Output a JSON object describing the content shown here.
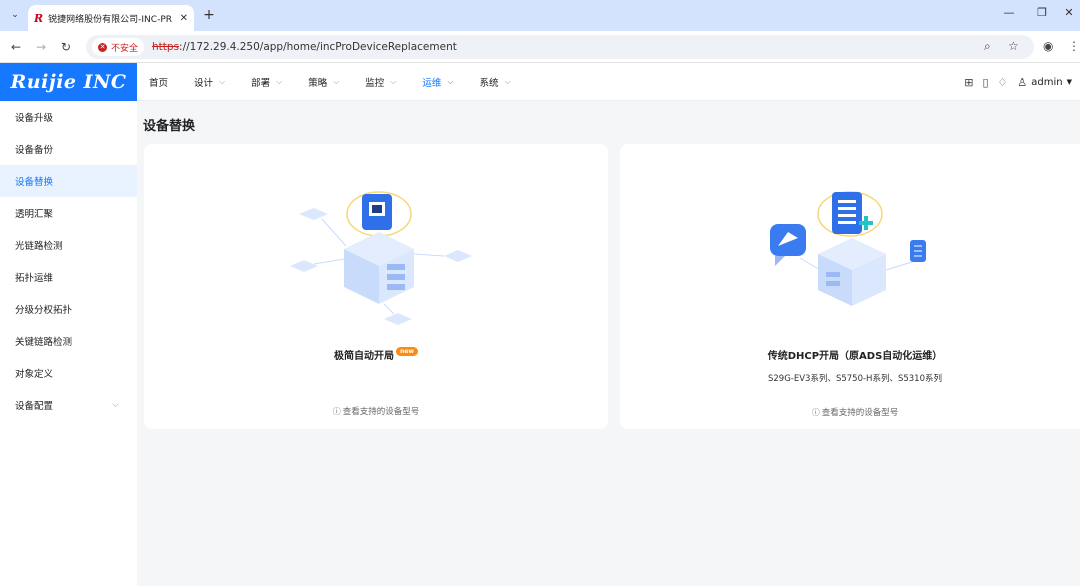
{
  "browser": {
    "tab_title": "锐捷网络股份有限公司-INC-PR",
    "tab_favicon": "R",
    "insecure_label": "不安全",
    "url_scheme": "https",
    "url_rest": "://172.29.4.250/app/home/incProDeviceReplacement"
  },
  "header": {
    "logo": "Ruijie INC",
    "nav": [
      {
        "label": "首页",
        "has_dropdown": false,
        "active": false
      },
      {
        "label": "设计",
        "has_dropdown": true,
        "active": false
      },
      {
        "label": "部署",
        "has_dropdown": true,
        "active": false
      },
      {
        "label": "策略",
        "has_dropdown": true,
        "active": false
      },
      {
        "label": "监控",
        "has_dropdown": true,
        "active": false
      },
      {
        "label": "运维",
        "has_dropdown": true,
        "active": true
      },
      {
        "label": "系统",
        "has_dropdown": true,
        "active": false
      }
    ],
    "user": "admin"
  },
  "sidebar": {
    "items": [
      {
        "label": "设备升级"
      },
      {
        "label": "设备备份"
      },
      {
        "label": "设备替换",
        "active": true
      },
      {
        "label": "透明汇聚"
      },
      {
        "label": "光链路检测"
      },
      {
        "label": "拓扑运维"
      },
      {
        "label": "分级分权拓扑"
      },
      {
        "label": "关键链路检测"
      },
      {
        "label": "对象定义"
      },
      {
        "label": "设备配置",
        "expandable": true
      }
    ]
  },
  "main": {
    "title": "设备替换",
    "cards": [
      {
        "title": "极简自动开局",
        "badge": "new",
        "subtitle": "",
        "link": "查看支持的设备型号"
      },
      {
        "title": "传统DHCP开局（原ADS自动化运维）",
        "subtitle": "S29G-EV3系列、S5750-H系列、S5310系列",
        "link": "查看支持的设备型号"
      }
    ]
  },
  "colors": {
    "accent": "#1677ff",
    "active_bg": "#e8f3ff",
    "badge": "#fa8c16",
    "insecure": "#c5221f"
  }
}
